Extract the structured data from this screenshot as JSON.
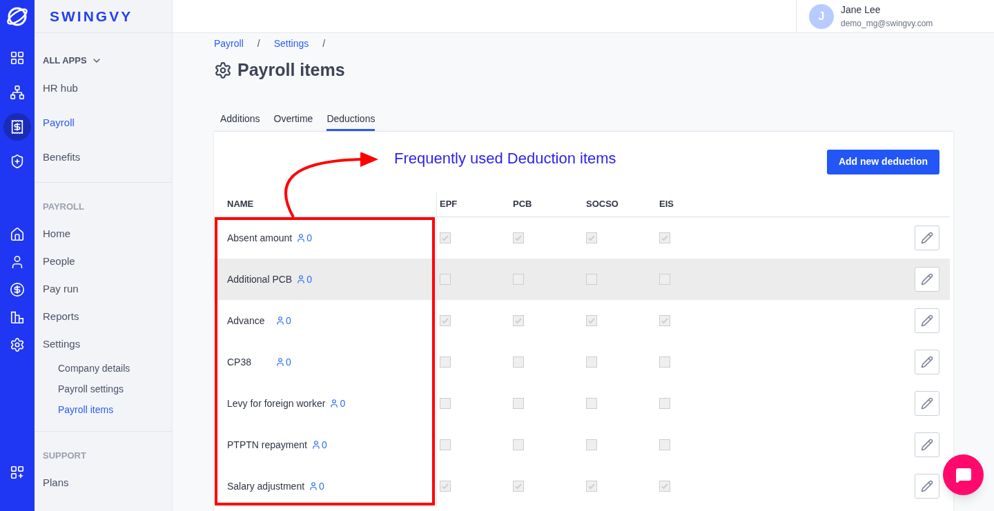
{
  "brand": "SWINGVY",
  "user": {
    "initial": "J",
    "name": "Jane Lee",
    "email": "demo_mg@swingvy.com"
  },
  "rail_icons": [
    {
      "kind": "grid",
      "selected": false
    },
    {
      "kind": "network",
      "selected": false
    },
    {
      "kind": "payroll",
      "selected": true
    },
    {
      "kind": "shield",
      "selected": false
    },
    {
      "kind": "home",
      "selected": false
    },
    {
      "kind": "user",
      "selected": false
    },
    {
      "kind": "payrun",
      "selected": false
    },
    {
      "kind": "reports",
      "selected": false
    },
    {
      "kind": "settings",
      "selected": false
    },
    {
      "kind": "apps",
      "selected": false
    }
  ],
  "apps_menu": {
    "label": "ALL APPS",
    "items": [
      {
        "label": "HR hub",
        "selected": false
      },
      {
        "label": "Payroll",
        "selected": true
      },
      {
        "label": "Benefits",
        "selected": false
      }
    ]
  },
  "payroll_section": {
    "heading": "PAYROLL",
    "items": [
      {
        "label": "Home",
        "selected": false
      },
      {
        "label": "People",
        "selected": false
      },
      {
        "label": "Pay run",
        "selected": false
      },
      {
        "label": "Reports",
        "selected": false
      },
      {
        "label": "Settings",
        "selected": false,
        "children": [
          {
            "label": "Company details",
            "selected": false
          },
          {
            "label": "Payroll settings",
            "selected": false
          },
          {
            "label": "Payroll items",
            "selected": true
          }
        ]
      }
    ]
  },
  "support_section": {
    "heading": "SUPPORT",
    "items": [
      {
        "label": "Plans",
        "selected": false
      }
    ]
  },
  "breadcrumb": [
    "Payroll",
    "Settings"
  ],
  "breadcrumb_separator": "/",
  "page_title": "Payroll items",
  "tabs": [
    {
      "label": "Additions",
      "selected": false
    },
    {
      "label": "Overtime",
      "selected": false
    },
    {
      "label": "Deductions",
      "selected": true
    }
  ],
  "annotation": {
    "text": "Frequently used Deduction items"
  },
  "add_button": "Add new deduction",
  "table": {
    "columns": [
      "NAME",
      "EPF",
      "PCB",
      "SOCSO",
      "EIS"
    ],
    "rows": [
      {
        "name": "Absent amount",
        "count": "0",
        "highlighted": false,
        "checks": [
          true,
          true,
          true,
          true
        ]
      },
      {
        "name": "Additional PCB",
        "count": "0",
        "highlighted": true,
        "checks": [
          false,
          false,
          false,
          false
        ]
      },
      {
        "name": "Advance",
        "count": "0",
        "highlighted": false,
        "checks": [
          true,
          true,
          true,
          true
        ]
      },
      {
        "name": "CP38",
        "count": "0",
        "highlighted": false,
        "checks": [
          false,
          false,
          false,
          false
        ]
      },
      {
        "name": "Levy for foreign worker",
        "count": "0",
        "highlighted": false,
        "checks": [
          false,
          false,
          false,
          false
        ]
      },
      {
        "name": "PTPTN repayment",
        "count": "0",
        "highlighted": false,
        "checks": [
          false,
          false,
          false,
          false
        ]
      },
      {
        "name": "Salary adjustment",
        "count": "0",
        "highlighted": false,
        "checks": [
          true,
          true,
          true,
          true
        ]
      }
    ]
  }
}
